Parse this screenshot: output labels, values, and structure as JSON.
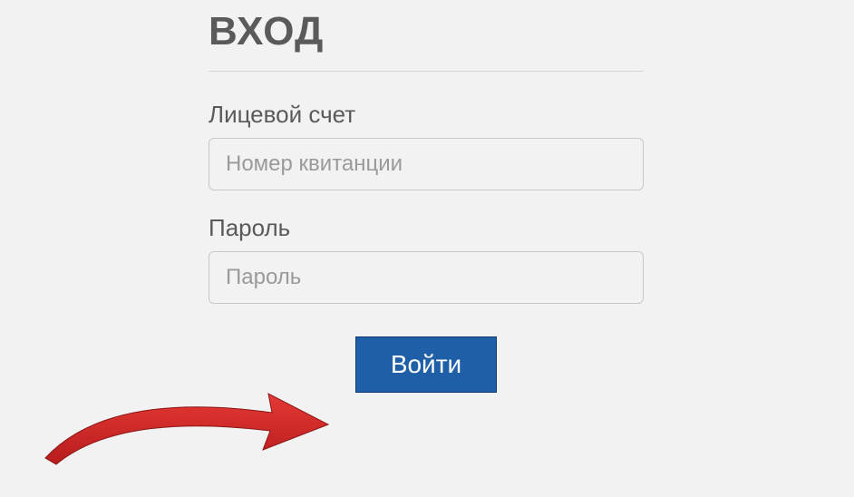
{
  "title": "ВХОД",
  "fields": {
    "account": {
      "label": "Лицевой счет",
      "placeholder": "Номер квитанции",
      "value": ""
    },
    "password": {
      "label": "Пароль",
      "placeholder": "Пароль",
      "value": ""
    }
  },
  "submit_label": "Войти",
  "colors": {
    "primary": "#1f5fa8",
    "arrow": "#d62828"
  }
}
